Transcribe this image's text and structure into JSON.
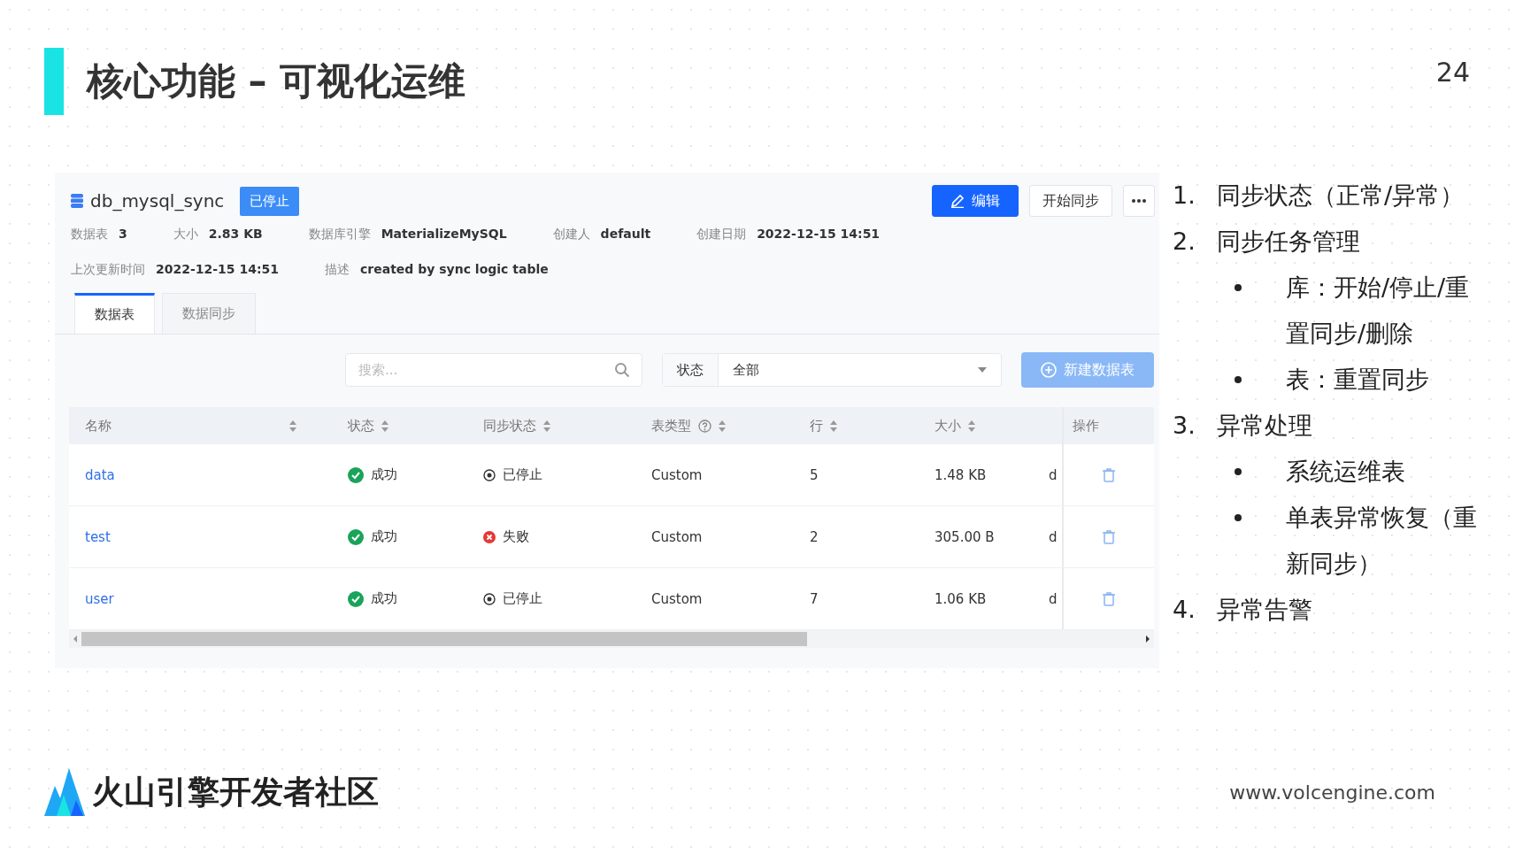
{
  "slide": {
    "title": "核心功能 – 可视化运维",
    "page_number": "24"
  },
  "app": {
    "db_name": "db_mysql_sync",
    "status_badge": "已停止",
    "actions": [
      {
        "kind": "primary",
        "label": "编辑"
      },
      {
        "kind": "default",
        "label": "开始同步"
      },
      {
        "kind": "more"
      }
    ],
    "meta": [
      [
        {
          "label": "数据表",
          "value": "3"
        },
        {
          "label": "大小",
          "value": "2.83 KB"
        },
        {
          "label": "数据库引擎",
          "value": "MaterializeMySQL"
        },
        {
          "label": "创建人",
          "value": "default"
        },
        {
          "label": "创建日期",
          "value": "2022-12-15 14:51"
        }
      ],
      [
        {
          "label": "上次更新时间",
          "value": "2022-12-15 14:51"
        },
        {
          "label": "描述",
          "value": "created by sync logic table"
        }
      ]
    ],
    "tabs": [
      {
        "label": "数据表",
        "selected": true
      },
      {
        "label": "数据同步",
        "selected": false
      }
    ],
    "search": {
      "placeholder": "搜索..."
    },
    "status_filter": {
      "label": "状态",
      "value": "全部"
    },
    "new_button": {
      "label": "新建数据表",
      "disabled": true
    },
    "table": {
      "columns": [
        {
          "label": "名称",
          "sortable": true,
          "help": false
        },
        {
          "label": "状态",
          "sortable": true,
          "help": false
        },
        {
          "label": "同步状态",
          "sortable": true,
          "help": false
        },
        {
          "label": "表类型",
          "sortable": true,
          "help": true
        },
        {
          "label": "行",
          "sortable": true,
          "help": false
        },
        {
          "label": "大小",
          "sortable": true,
          "help": false
        },
        {
          "label": "操作",
          "sortable": false,
          "help": false
        }
      ],
      "rows": [
        {
          "name": "data",
          "status": {
            "kind": "success",
            "text": "成功"
          },
          "sync_status": {
            "kind": "stopped",
            "text": "已停止"
          },
          "table_type": "Custom",
          "row_count": "5",
          "size": "1.48 KB",
          "column_7": "d"
        },
        {
          "name": "test",
          "status": {
            "kind": "success",
            "text": "成功"
          },
          "sync_status": {
            "kind": "failed",
            "text": "失败"
          },
          "table_type": "Custom",
          "row_count": "2",
          "size": "305.00 B",
          "column_7": "d"
        },
        {
          "name": "user",
          "status": {
            "kind": "success",
            "text": "成功"
          },
          "sync_status": {
            "kind": "stopped",
            "text": "已停止"
          },
          "table_type": "Custom",
          "row_count": "7",
          "size": "1.06 KB",
          "column_7": "d"
        }
      ]
    }
  },
  "notes": [
    {
      "marker": "1.",
      "text": "同步状态（正常/异常）"
    },
    {
      "marker": "2.",
      "text": "同步任务管理",
      "children": [
        {
          "text": "库：开始/停止/重置同步/删除"
        },
        {
          "text": "表：重置同步"
        }
      ]
    },
    {
      "marker": "3.",
      "text": "异常处理",
      "children": [
        {
          "text": "系统运维表"
        },
        {
          "text": "单表异常恢复（重新同步）"
        }
      ]
    },
    {
      "marker": "4.",
      "text": "异常告警"
    }
  ],
  "footer": {
    "brand": "火山引擎开发者社区",
    "url": "www.volcengine.com"
  }
}
